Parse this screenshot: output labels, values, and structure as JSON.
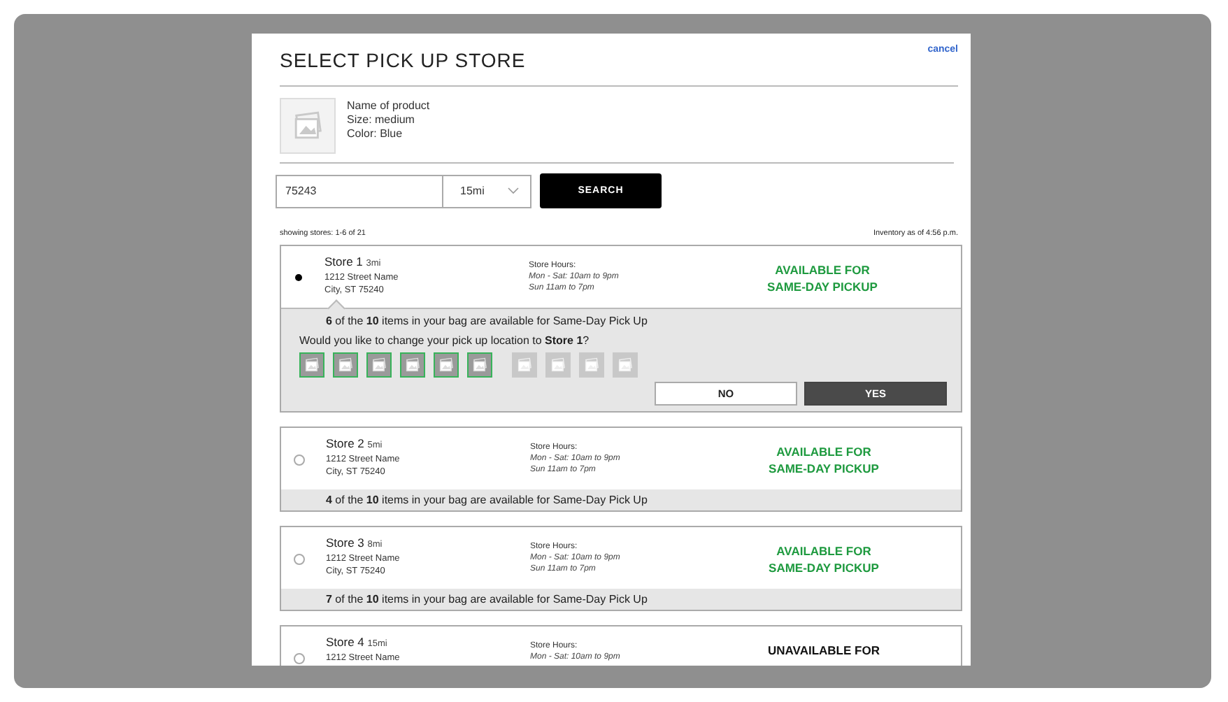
{
  "dialog": {
    "title": "SELECT PICK UP STORE",
    "cancel": "cancel"
  },
  "product": {
    "lines": [
      "Name of product",
      "Size: medium",
      "Color: Blue"
    ]
  },
  "search": {
    "zip": "75243",
    "radius": "15mi",
    "button": "SEARCH"
  },
  "showing": "showing stores: 1-6 of 21",
  "inventory": "Inventory as of 4:56 p.m.",
  "stores": [
    {
      "name": "Store 1",
      "distance": "3mi",
      "address": [
        "1212 Street Name",
        "City, ST 75240"
      ],
      "hours_title": "Store Hours:",
      "hours": [
        "Mon - Sat: 10am to 9pm",
        "Sun 11am to 7pm"
      ],
      "availability": [
        "AVAILABLE FOR",
        "SAME-DAY PICKUP"
      ],
      "available": true,
      "selected": true,
      "expanded": true,
      "summary": "**6** of the **10** items in your bag are available for Same-Day Pick Up",
      "question": "Would you like to change your pick up location to **Store 1**?",
      "items": [
        {
          "in_stock": true
        },
        {
          "in_stock": true
        },
        {
          "in_stock": true
        },
        {
          "in_stock": true
        },
        {
          "in_stock": true
        },
        {
          "in_stock": true
        },
        {
          "in_stock": false
        },
        {
          "in_stock": false
        },
        {
          "in_stock": false
        },
        {
          "in_stock": false
        }
      ],
      "buttons": [
        "NO",
        "YES"
      ]
    },
    {
      "name": "Store 2",
      "distance": "5mi",
      "address": [
        "1212 Street Name",
        "City, ST 75240"
      ],
      "hours_title": "Store Hours:",
      "hours": [
        "Mon - Sat: 10am to 9pm",
        "Sun 11am to 7pm"
      ],
      "availability": [
        "AVAILABLE FOR",
        "SAME-DAY PICKUP"
      ],
      "available": true,
      "selected": false,
      "expanded": false,
      "summary": "**4** of the **10** items in your bag are available for Same-Day Pick Up"
    },
    {
      "name": "Store 3",
      "distance": "8mi",
      "address": [
        "1212 Street Name",
        "City, ST 75240"
      ],
      "hours_title": "Store Hours:",
      "hours": [
        "Mon - Sat: 10am to 9pm",
        "Sun 11am to 7pm"
      ],
      "availability": [
        "AVAILABLE FOR",
        "SAME-DAY PICKUP"
      ],
      "available": true,
      "selected": false,
      "expanded": false,
      "summary": "**7** of the **10** items in your bag are available for Same-Day Pick Up"
    },
    {
      "name": "Store 4",
      "distance": "15mi",
      "address": [
        "1212 Street Name"
      ],
      "hours_title": "Store Hours:",
      "hours": [
        "Mon - Sat: 10am to 9pm"
      ],
      "availability": [
        "UNAVAILABLE FOR"
      ],
      "available": false,
      "selected": false,
      "expanded": false
    }
  ]
}
